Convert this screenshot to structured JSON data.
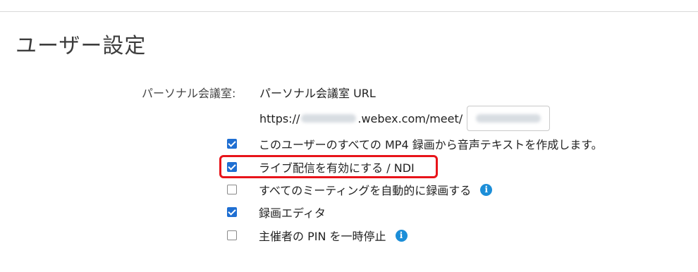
{
  "page": {
    "title": "ユーザー設定"
  },
  "personal_room": {
    "label": "パーソナル会議室:",
    "url_heading": "パーソナル会議室 URL",
    "url_prefix": "https://",
    "url_domain": ".webex.com/meet/"
  },
  "options": [
    {
      "label": "このユーザーのすべての MP4 録画から音声テキストを作成します。",
      "checked": true,
      "info": false
    },
    {
      "label": "ライブ配信を有効にする / NDI",
      "checked": true,
      "info": false,
      "highlighted": true
    },
    {
      "label": "すべてのミーティングを自動的に録画する",
      "checked": false,
      "info": true
    },
    {
      "label": "録画エディタ",
      "checked": true,
      "info": false
    },
    {
      "label": "主催者の PIN を一時停止",
      "checked": false,
      "info": true
    }
  ],
  "colors": {
    "checkbox_checked": "#1f6fd2",
    "info_icon": "#1c8ed8",
    "highlight_border": "#e8141a"
  },
  "icons": {
    "info": "info-icon",
    "checkbox": "checkbox"
  }
}
